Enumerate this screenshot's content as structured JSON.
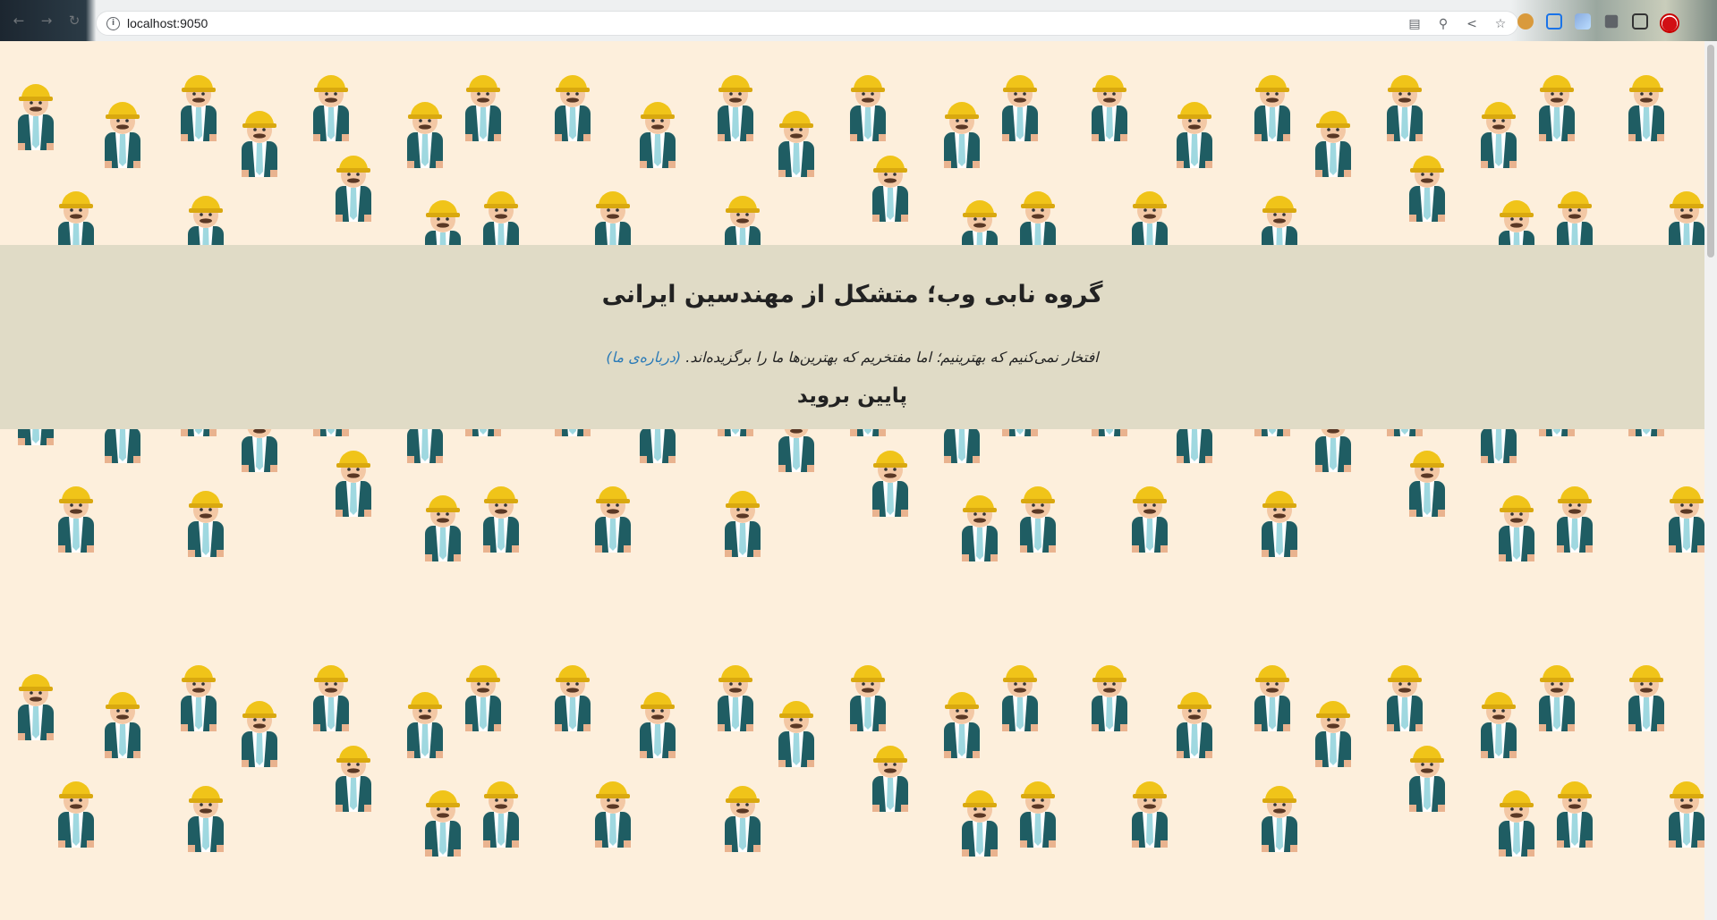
{
  "browser": {
    "url": "localhost:9050",
    "nav_icons": [
      "back-arrow-icon",
      "forward-arrow-icon",
      "reload-icon"
    ],
    "omnibox_actions": [
      "translate-icon",
      "zoom-icon",
      "share-icon",
      "bookmark-star-icon"
    ],
    "extensions": [
      "cookie-extension-icon",
      "screen-extension-icon",
      "feather-extension-icon",
      "puzzle-extensions-icon",
      "sidepanel-icon",
      "profile-avatar"
    ]
  },
  "page": {
    "background_color": "#fdefdc",
    "pattern_icon": "engineer-hardhat-icon",
    "banner": {
      "title": "گروه نابی وب؛ متشکل از مهندسین ایرانی",
      "tagline": "افتخار نمی‌کنیم که بهترینیم؛ اما مفتخریم که بهترین‌ها ما را برگزیده‌اند.",
      "about_link": "(درباره‌ی ما)",
      "scroll_hint": "پایین بروید"
    }
  },
  "colors": {
    "banner_bg": "#e0dbc6",
    "link": "#2a7ab7",
    "helmet": "#f0c419",
    "suit": "#1f5d63"
  }
}
